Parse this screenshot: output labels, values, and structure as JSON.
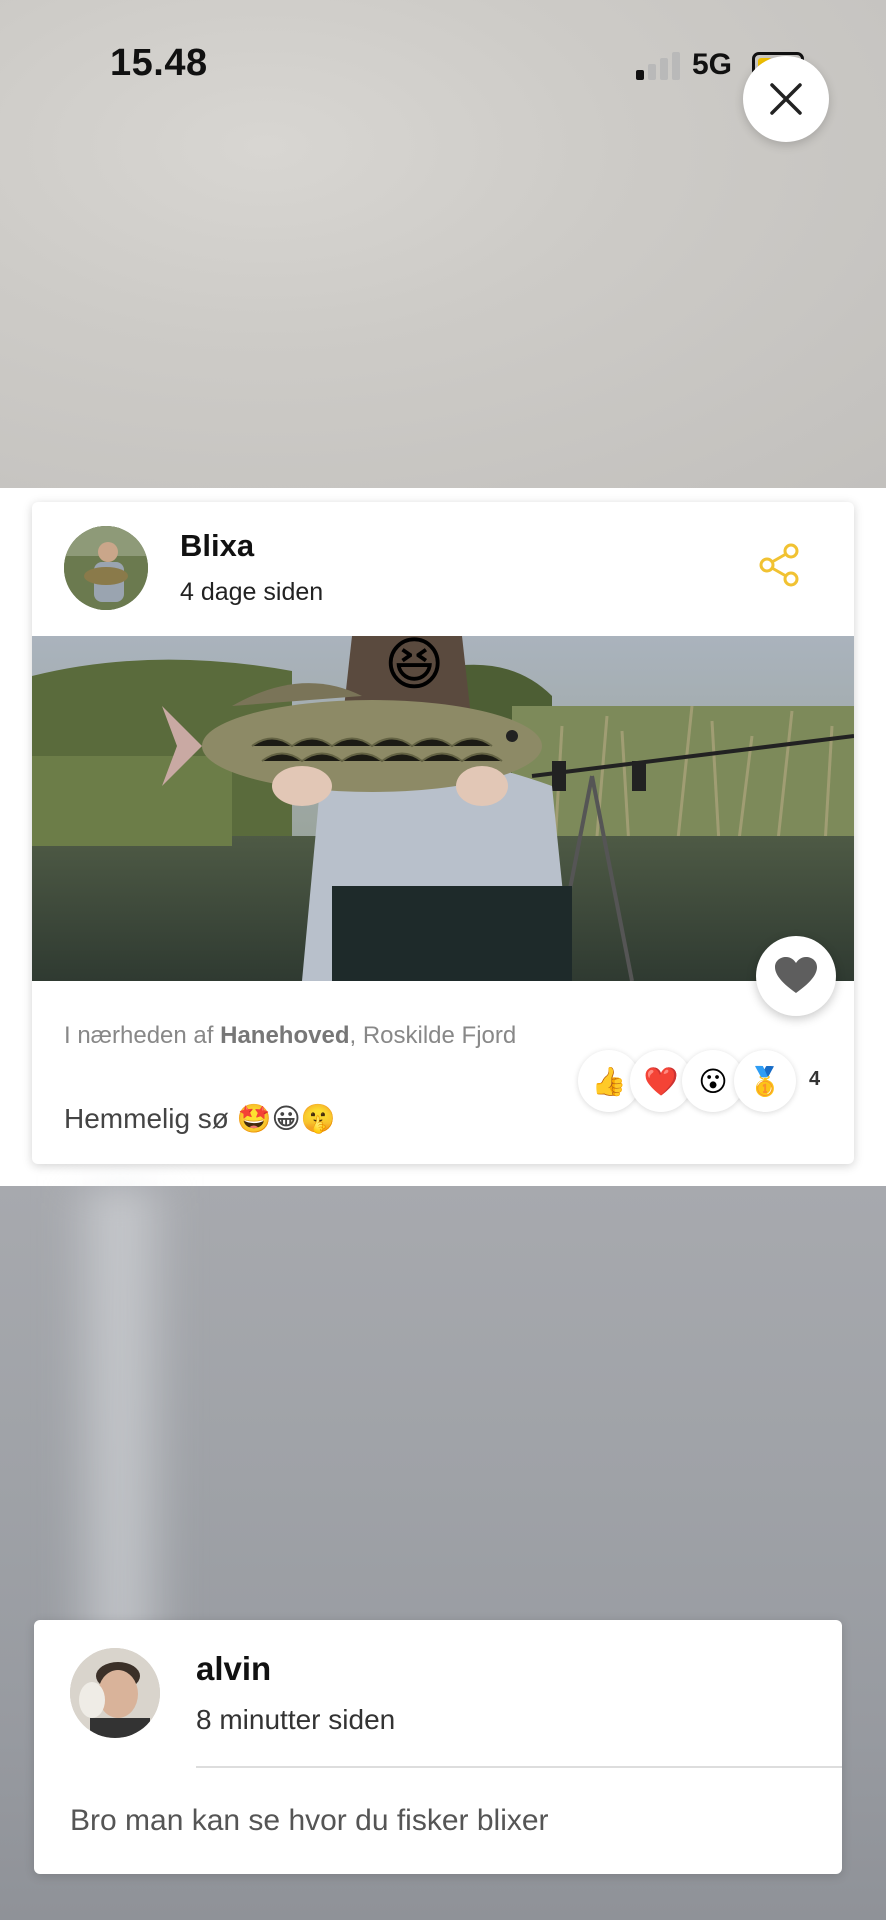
{
  "status_bar": {
    "time": "15.48",
    "network": "5G",
    "battery_level": 0.25,
    "battery_color": "#f2c100"
  },
  "close_button": {
    "icon": "close-icon"
  },
  "post": {
    "author": "Blixa",
    "time_ago": "4 dage siden",
    "share_icon": "share-icon",
    "share_color": "#f1c232",
    "location_prefix": "I nærheden af ",
    "location_place": "Hanehoved",
    "location_suffix": ", Roskilde Fjord",
    "caption": "Hemmelig sø 🤩😀🤫",
    "like_icon": "heart-icon",
    "reactions": [
      "👍",
      "❤️",
      "😮",
      "🥇"
    ],
    "reaction_count": "4",
    "photo_overlay_emoji": "😆"
  },
  "comment": {
    "author": "alvin",
    "time_ago": "8 minutter siden",
    "text": "Bro man kan se hvor du fisker blixer"
  }
}
